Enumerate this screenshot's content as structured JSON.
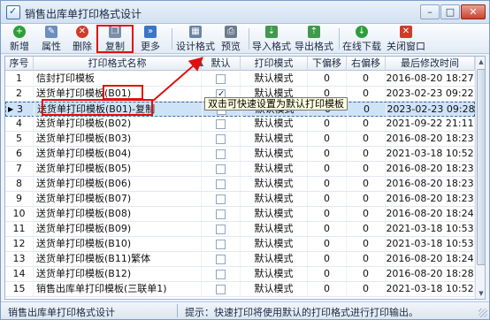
{
  "window": {
    "title": "销售出库单打印格式设计",
    "controls": {
      "minimize": "–",
      "maximize": "□",
      "close": "✕"
    }
  },
  "toolbar": {
    "buttons": [
      {
        "id": "add",
        "label": "新增",
        "icon": "add-icon",
        "color": "#2e9e3a",
        "glyph": "+"
      },
      {
        "id": "props",
        "label": "属性",
        "icon": "edit-icon",
        "color": "#6b8fc0",
        "glyph": "✎"
      },
      {
        "id": "delete",
        "label": "删除",
        "icon": "delete-icon",
        "color": "#d13b2a",
        "glyph": "✕"
      },
      {
        "id": "copy",
        "label": "复制",
        "icon": "copy-icon",
        "color": "#7a8fa8",
        "glyph": "❐"
      },
      {
        "id": "more",
        "label": "更多",
        "icon": "more-icon",
        "color": "#3a76c8",
        "glyph": "»"
      },
      {
        "id": "design",
        "label": "设计格式",
        "icon": "design-icon",
        "color": "#6a84a8",
        "glyph": "▦"
      },
      {
        "id": "preview",
        "label": "预览",
        "icon": "preview-icon",
        "color": "#6c7a8c",
        "glyph": "⎙"
      },
      {
        "id": "import",
        "label": "导入格式",
        "icon": "import-icon",
        "color": "#3f9a4c",
        "glyph": "⇣"
      },
      {
        "id": "export",
        "label": "导出格式",
        "icon": "export-icon",
        "color": "#3f9a4c",
        "glyph": "⇡"
      },
      {
        "id": "download",
        "label": "在线下载",
        "icon": "download-icon",
        "color": "#2e9e3a",
        "glyph": "↓"
      },
      {
        "id": "close",
        "label": "关闭窗口",
        "icon": "close-window-icon",
        "color": "#d13b2a",
        "glyph": "✕"
      }
    ]
  },
  "grid": {
    "columns": [
      "序号",
      "打印格式名称",
      "默认",
      "打印模式",
      "下偏移",
      "右偏移",
      "最后修改时间"
    ],
    "rows": [
      {
        "no": "1",
        "name": "信封打印模板",
        "default": false,
        "mode": "默认模式",
        "down": "0",
        "right": "0",
        "modified": "2016-08-20 18:27"
      },
      {
        "no": "2",
        "name": "送货单打印模板(B01)",
        "default": true,
        "mode": "默认模式",
        "down": "0",
        "right": "0",
        "modified": "2023-02-23 09:22"
      },
      {
        "no": "3",
        "name": "送货单打印模板(B01)-复制",
        "default": false,
        "mode": "默认模式",
        "down": "0",
        "right": "0",
        "modified": "2023-02-23 09:28"
      },
      {
        "no": "4",
        "name": "送货单打印模板(B02)",
        "default": false,
        "mode": "默认模式",
        "down": "0",
        "right": "0",
        "modified": "2021-09-22 21:11"
      },
      {
        "no": "5",
        "name": "送货单打印模板(B03)",
        "default": false,
        "mode": "默认模式",
        "down": "0",
        "right": "0",
        "modified": "2016-08-20 18:23"
      },
      {
        "no": "6",
        "name": "送货单打印模板(B04)",
        "default": false,
        "mode": "默认模式",
        "down": "0",
        "right": "0",
        "modified": "2021-03-18 10:52"
      },
      {
        "no": "7",
        "name": "送货单打印模板(B05)",
        "default": false,
        "mode": "默认模式",
        "down": "0",
        "right": "0",
        "modified": "2016-08-20 18:23"
      },
      {
        "no": "8",
        "name": "送货单打印模板(B06)",
        "default": false,
        "mode": "默认模式",
        "down": "0",
        "right": "0",
        "modified": "2016-08-20 18:23"
      },
      {
        "no": "9",
        "name": "送货单打印模板(B07)",
        "default": false,
        "mode": "默认模式",
        "down": "0",
        "right": "0",
        "modified": "2016-08-20 18:23"
      },
      {
        "no": "10",
        "name": "送货单打印模板(B08)",
        "default": false,
        "mode": "默认模式",
        "down": "0",
        "right": "0",
        "modified": "2016-08-20 18:24"
      },
      {
        "no": "11",
        "name": "送货单打印模板(B09)",
        "default": false,
        "mode": "默认模式",
        "down": "0",
        "right": "0",
        "modified": "2021-03-18 10:53"
      },
      {
        "no": "12",
        "name": "送货单打印模板(B10)",
        "default": false,
        "mode": "默认模式",
        "down": "0",
        "right": "0",
        "modified": "2021-03-18 10:53"
      },
      {
        "no": "13",
        "name": "送货单打印模板(B11)繁体",
        "default": false,
        "mode": "默认模式",
        "down": "0",
        "right": "0",
        "modified": "2016-08-20 18:24"
      },
      {
        "no": "14",
        "name": "送货单打印模板(B12)",
        "default": false,
        "mode": "默认模式",
        "down": "0",
        "right": "0",
        "modified": "2016-08-20 18:28"
      },
      {
        "no": "15",
        "name": "销售出库单打印模板(三联单1)",
        "default": false,
        "mode": "默认模式",
        "down": "0",
        "right": "0",
        "modified": "2021-03-18 10:52"
      }
    ],
    "tooltip": "双击可快速设置为默认打印模板",
    "selected_row_index": 2
  },
  "status": {
    "left": "销售出库单打印格式设计",
    "right": "提示：快速打印将使用默认的打印格式进行打印输出。"
  },
  "colors": {
    "annotation": "#e01010",
    "selection": "#cfe3f7",
    "accent": "#3a6ea5"
  }
}
